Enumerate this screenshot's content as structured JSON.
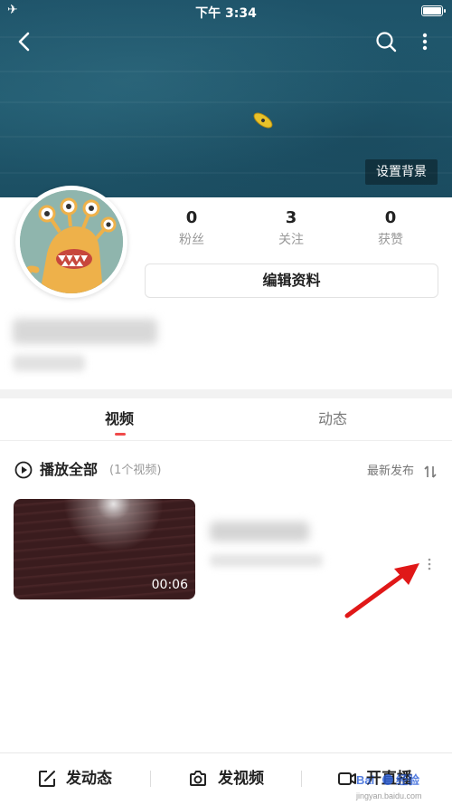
{
  "status_bar": {
    "time": "下午 3:34",
    "airplane_glyph": "✈"
  },
  "header": {
    "set_background_label": "设置背景"
  },
  "profile": {
    "stats": [
      {
        "value": "0",
        "label": "粉丝"
      },
      {
        "value": "3",
        "label": "关注"
      },
      {
        "value": "0",
        "label": "获赞"
      }
    ],
    "edit_profile_label": "编辑资料"
  },
  "tabs": [
    {
      "label": "视频",
      "active": true
    },
    {
      "label": "动态",
      "active": false
    }
  ],
  "video_list": {
    "play_all_label": "播放全部",
    "count_label": "(1个视频)",
    "sort_label": "最新发布",
    "items": [
      {
        "duration": "00:06"
      }
    ]
  },
  "bottom_bar": {
    "items": [
      {
        "label": "发动态",
        "icon": "edit-icon"
      },
      {
        "label": "发视频",
        "icon": "camera-icon"
      },
      {
        "label": "开直播",
        "icon": "live-video-icon"
      }
    ]
  },
  "colors": {
    "accent": "#f04a4a",
    "banner": "#215b70",
    "arrow": "#e01818"
  },
  "watermark": {
    "text": "Bai 经验",
    "url_text": "jingyan.baidu.com"
  }
}
